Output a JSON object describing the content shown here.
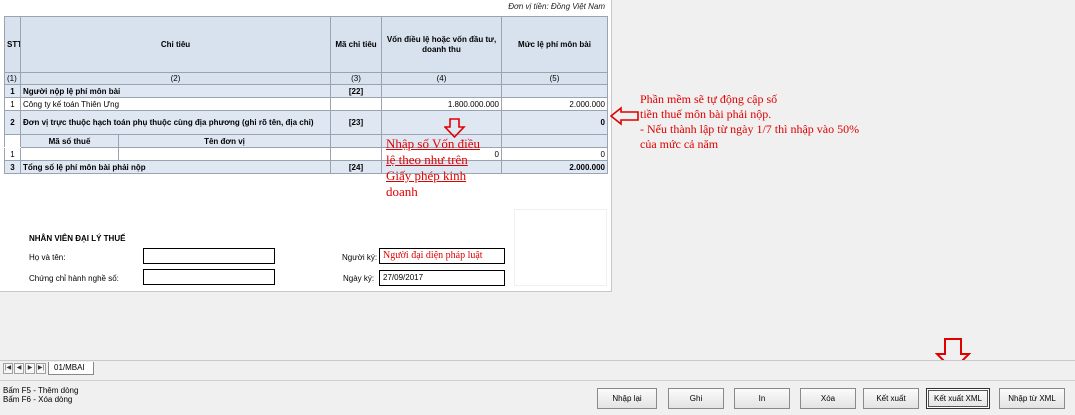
{
  "form": {
    "currency_unit": "Đơn vị tiền: Đồng Việt Nam",
    "headers": {
      "stt": "STT",
      "criteria": "Chỉ tiêu",
      "code": "Mã chỉ tiêu",
      "capital": "Vốn điều lệ hoặc vốn đầu tư, doanh thu",
      "fee": "Mức lệ phí môn bài"
    },
    "index_row": [
      "(1)",
      "(2)",
      "(3)",
      "(4)",
      "(5)"
    ],
    "rows": {
      "r1": {
        "stt": "1",
        "label": "Người nộp lệ phí môn bài",
        "code": "[22]"
      },
      "r1_1": {
        "stt": "1",
        "label": "Công ty kế toán Thiên Ưng",
        "capital": "1.800.000.000",
        "fee": "2.000.000"
      },
      "r2": {
        "stt": "2",
        "label": "Đơn vị trực thuộc hạch toán phụ thuộc cùng địa phương (ghi rõ tên, địa chỉ)",
        "code": "[23]",
        "fee": "0"
      },
      "r2_sub": {
        "tax_code": "Mã số thuế",
        "unit_name": "Tên đơn vị"
      },
      "r2_1": {
        "stt": "1",
        "capital": "0",
        "fee": "0"
      },
      "r3": {
        "stt": "3",
        "label": "Tổng số lệ phí môn bài phải nộp",
        "code": "[24]",
        "fee": "2.000.000"
      }
    }
  },
  "agent": {
    "title": "NHÂN VIÊN ĐẠI LÝ THUẾ",
    "name_label": "Họ và tên:",
    "name_value": "",
    "cert_label": "Chứng chỉ hành nghề số:",
    "cert_value": "",
    "signer_label": "Người ký:",
    "signer_value": "Người đại diện pháp luật",
    "date_label": "Ngày ký:",
    "date_value": "27/09/2017"
  },
  "annotations": {
    "capital_note": [
      "Nhập số Vốn điều",
      "lệ theo như trên",
      "Giấy phép kinh",
      "doanh"
    ],
    "fee_note": [
      "Phần mềm sẽ tự động cập số",
      "tiền thuế môn bài phải nộp.",
      "- Nếu thành lập từ ngày 1/7 thì nhập vào 50%",
      "của mức cả năm"
    ],
    "color": "#e00000"
  },
  "tabs": {
    "nav": [
      "|◀",
      "◀",
      "▶",
      "▶|"
    ],
    "sheet": "01/MBAI"
  },
  "status": {
    "hint1": "Bấm F5 - Thêm dòng",
    "hint2": "Bấm F6 - Xóa dòng"
  },
  "buttons": {
    "reset": "Nhập lại",
    "save": "Ghi",
    "print": "In",
    "delete": "Xóa",
    "export": "Kết xuất",
    "export_xml": "Kết xuất XML",
    "import_xml": "Nhập từ XML"
  },
  "colors": {
    "header_bg": "#d8e1ee",
    "section_bg": "#dfe7f3",
    "annotation_red": "#e00000"
  }
}
